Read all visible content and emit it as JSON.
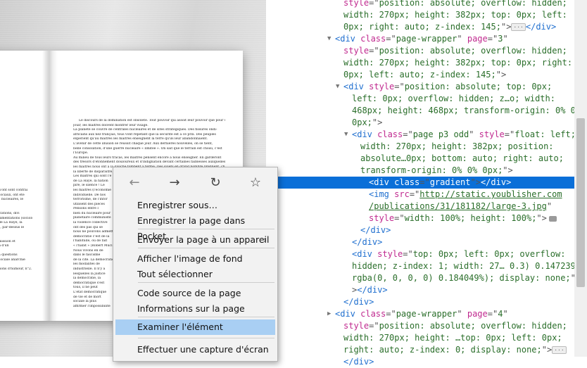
{
  "book": {
    "left_lines": [
      "",
      "",
      "",
      "",
      "",
      "",
      "",
      "n'ont sont contrai",
      "sociaux, ont été",
      "s nucléaires, le",
      "",
      "",
      "ications, divi",
      "lamentations (sociologie)",
      "de La Haye, la",
      "s, par-dessus le",
      "",
      "",
      "mission et",
      "n d'un",
      "",
      "à questions",
      "sociale anarchie",
      "",
      "tions d'humour, n°2.",
      "",
      "",
      "",
      "",
      "",
      "",
      ""
    ],
    "right_lines": [
      "Le discours de la domination est obsolète. Tout pouvoir qui assoit leur pouvoir que pour un",
      "jouir, les maîtres doivent montrer leur visage.",
      "La planète se couvre de centrales nucléaires et de sites stratégiques. Des fissurés ondi-",
      "africains aux nez français, tous vont répétant que la sécurité est à ce prix. Des peuples",
      "expérient qu'au maîtres les maîtres enseignent la terre qu'ils leur abandonnaient.",
      "L'avenir de cette illusion se réussit chaque jour. Aux dernières nouvelles, on se tient,",
      "belle consolation, d'une guerre nucléaire « limitée ». On sait que le terrain est choisi, c'est",
      "l'Europe.",
      "Au milieu de tous leurs tracas, les maîtres pensent encore à nous enseigner. En garderont",
      "des trésors d'étonnement douloureux et d'indignation devant certaines faiblesses auxquelles",
      "les maîtres nous ont à la gauche tombent à terme. Des sujets en grand nombre prennent, chaque",
      "la liberté de disparaître. Ceux qui ne sont pas des maîtres",
      "Les maîtres qui sont l'é",
      "de La Haye, la nation",
      "pire, le silence ! Le",
      "les maîtres (l'économie",
      "individuelle. De nos",
      "terrorisme, de l'infor",
      "utilisent des pièces",
      "Pensons entre l",
      "bien du nucléaire pour",
      "planétaire communiste",
      "la violence collective",
      "ont des pas qui se",
      "nous ne pouvons admettre",
      "démocratie c'est de la",
      "l'habitude, ou de fait",
      "« l'habit » (Robert Mucl",
      "Nous vivons en dé",
      "dans le fascisme",
      "de la cité. La démocratie",
      "les modalités de",
      "industrielle. Il n'y a",
      "lesquelles la justice",
      "la démocratie, la",
      "démocratique s'est",
      "tous, il ne peut",
      "L'état démocratique",
      "de vie et de mort",
      "sociale la plus",
      "affirmer l'impossibilité",
      "",
      "",
      ""
    ]
  },
  "devtools": {
    "lines": [
      {
        "indent": 1,
        "t": "none",
        "tokens": [
          {
            "c": "attr",
            "t": "style"
          },
          {
            "c": "kw",
            "t": "=\""
          },
          {
            "c": "val",
            "t": "position: absolute; overflow: hidden;"
          }
        ]
      },
      {
        "indent": 1,
        "t": "none",
        "tokens": [
          {
            "c": "val",
            "t": "width: 270px; height: 382px; top: 0px; left:"
          }
        ]
      },
      {
        "indent": 1,
        "t": "none",
        "tokens": [
          {
            "c": "val",
            "t": "0px; right: auto; z-index: 145;"
          },
          {
            "c": "kw",
            "t": "\">"
          },
          {
            "c": "ellip",
            "t": "···"
          },
          {
            "c": "tag",
            "t": "</div>"
          }
        ]
      },
      {
        "indent": 0,
        "t": "open",
        "tokens": [
          {
            "c": "tag",
            "t": "<div "
          },
          {
            "c": "attr",
            "t": "class"
          },
          {
            "c": "kw",
            "t": "=\""
          },
          {
            "c": "val",
            "t": "page-wrapper"
          },
          {
            "c": "kw",
            "t": "\" "
          },
          {
            "c": "attr",
            "t": "page"
          },
          {
            "c": "kw",
            "t": "=\""
          },
          {
            "c": "val",
            "t": "3"
          },
          {
            "c": "kw",
            "t": "\""
          }
        ]
      },
      {
        "indent": 1,
        "t": "none",
        "tokens": [
          {
            "c": "attr",
            "t": "style"
          },
          {
            "c": "kw",
            "t": "=\""
          },
          {
            "c": "val",
            "t": "position: absolute; overflow: hidden;"
          }
        ]
      },
      {
        "indent": 1,
        "t": "none",
        "tokens": [
          {
            "c": "val",
            "t": "width: 270px; height: 382px; top: 0px; right:"
          }
        ]
      },
      {
        "indent": 1,
        "t": "none",
        "tokens": [
          {
            "c": "val",
            "t": "0px; left: auto; z-index: 145;"
          },
          {
            "c": "kw",
            "t": "\">"
          }
        ]
      },
      {
        "indent": 1,
        "t": "open",
        "tokens": [
          {
            "c": "tag",
            "t": "<div "
          },
          {
            "c": "attr",
            "t": "style"
          },
          {
            "c": "kw",
            "t": "=\""
          },
          {
            "c": "val",
            "t": "position: absolute; top: 0px;"
          }
        ]
      },
      {
        "indent": 2,
        "t": "none",
        "tokens": [
          {
            "c": "val",
            "t": "left: 0px; overflow: hidden; z…o; width:"
          }
        ]
      },
      {
        "indent": 2,
        "t": "none",
        "tokens": [
          {
            "c": "val",
            "t": "468px; height: 468px; transform-origin: 0% 0%"
          }
        ]
      },
      {
        "indent": 2,
        "t": "none",
        "tokens": [
          {
            "c": "val",
            "t": "0px;"
          },
          {
            "c": "kw",
            "t": "\">"
          }
        ]
      },
      {
        "indent": 2,
        "t": "open",
        "tokens": [
          {
            "c": "tag",
            "t": "<div "
          },
          {
            "c": "attr",
            "t": "class"
          },
          {
            "c": "kw",
            "t": "=\""
          },
          {
            "c": "val",
            "t": "page p3 odd"
          },
          {
            "c": "kw",
            "t": "\" "
          },
          {
            "c": "attr",
            "t": "style"
          },
          {
            "c": "kw",
            "t": "=\""
          },
          {
            "c": "val",
            "t": "float: left;"
          }
        ]
      },
      {
        "indent": 3,
        "t": "none",
        "tokens": [
          {
            "c": "val",
            "t": "width: 270px; height: 382px; position:"
          }
        ]
      },
      {
        "indent": 3,
        "t": "none",
        "tokens": [
          {
            "c": "val",
            "t": "absolute…0px; bottom: auto; right: auto;"
          }
        ]
      },
      {
        "indent": 3,
        "t": "none",
        "tokens": [
          {
            "c": "val",
            "t": "transform-origin: 0% 0% 0px;"
          },
          {
            "c": "kw",
            "t": "\">"
          }
        ]
      },
      {
        "indent": 4,
        "t": "none",
        "sel": true,
        "tokens": [
          {
            "c": "tag",
            "t": "<div "
          },
          {
            "c": "attr",
            "t": "class"
          },
          {
            "c": "kw",
            "t": "=\""
          },
          {
            "c": "val",
            "t": "gradient"
          },
          {
            "c": "kw",
            "t": "\">"
          },
          {
            "c": "tag",
            "t": "</div>"
          }
        ]
      },
      {
        "indent": 4,
        "t": "none",
        "tokens": [
          {
            "c": "tag",
            "t": "<img "
          },
          {
            "c": "attr",
            "t": "src"
          },
          {
            "c": "kw",
            "t": "=\""
          },
          {
            "c": "link",
            "t": "http://static.youblisher.com"
          }
        ]
      },
      {
        "indent": 4,
        "t": "none",
        "tokens": [
          {
            "c": "link",
            "t": "/publications/31/181182/large-3.jpg"
          },
          {
            "c": "kw",
            "t": "\""
          }
        ]
      },
      {
        "indent": 4,
        "t": "none",
        "tokens": [
          {
            "c": "attr",
            "t": "style"
          },
          {
            "c": "kw",
            "t": "=\""
          },
          {
            "c": "val",
            "t": "width: 100%; height: 100%;"
          },
          {
            "c": "kw",
            "t": "\">"
          },
          {
            "c": "badge",
            "t": ""
          }
        ]
      },
      {
        "indent": 3,
        "t": "none",
        "tokens": [
          {
            "c": "tag",
            "t": "</div>"
          }
        ]
      },
      {
        "indent": 2,
        "t": "none",
        "tokens": [
          {
            "c": "tag",
            "t": "</div>"
          }
        ]
      },
      {
        "indent": 2,
        "t": "none",
        "tokens": [
          {
            "c": "tag",
            "t": "<div "
          },
          {
            "c": "attr",
            "t": "style"
          },
          {
            "c": "kw",
            "t": "=\""
          },
          {
            "c": "val",
            "t": "top: 0px; left: 0px; overflow:"
          }
        ]
      },
      {
        "indent": 2,
        "t": "none",
        "tokens": [
          {
            "c": "val",
            "t": "hidden; z-index: 1; width: 27… 0.3) 0.147239%,"
          }
        ]
      },
      {
        "indent": 2,
        "t": "none",
        "tokens": [
          {
            "c": "val",
            "t": "rgba(0, 0, 0, 0) 0.184049%); display: none;"
          },
          {
            "c": "kw",
            "t": "\""
          }
        ]
      },
      {
        "indent": 2,
        "t": "none",
        "tokens": [
          {
            "c": "kw",
            "t": ">"
          },
          {
            "c": "tag",
            "t": "</div>"
          }
        ]
      },
      {
        "indent": 1,
        "t": "none",
        "tokens": [
          {
            "c": "tag",
            "t": "</div>"
          }
        ]
      },
      {
        "indent": 0,
        "t": "closed",
        "tokens": [
          {
            "c": "tag",
            "t": "<div "
          },
          {
            "c": "attr",
            "t": "class"
          },
          {
            "c": "kw",
            "t": "=\""
          },
          {
            "c": "val",
            "t": "page-wrapper"
          },
          {
            "c": "kw",
            "t": "\" "
          },
          {
            "c": "attr",
            "t": "page"
          },
          {
            "c": "kw",
            "t": "=\""
          },
          {
            "c": "val",
            "t": "4"
          },
          {
            "c": "kw",
            "t": "\""
          }
        ]
      },
      {
        "indent": 1,
        "t": "none",
        "tokens": [
          {
            "c": "attr",
            "t": "style"
          },
          {
            "c": "kw",
            "t": "=\""
          },
          {
            "c": "val",
            "t": "position: absolute; overflow: hidden;"
          }
        ]
      },
      {
        "indent": 1,
        "t": "none",
        "tokens": [
          {
            "c": "val",
            "t": "width: 270px; height: …top: 0px; left: 0px;"
          }
        ]
      },
      {
        "indent": 1,
        "t": "none",
        "tokens": [
          {
            "c": "val",
            "t": "right: auto; z-index: 0; display: none;"
          },
          {
            "c": "kw",
            "t": "\">"
          },
          {
            "c": "ellip",
            "t": "···"
          }
        ]
      },
      {
        "indent": 1,
        "t": "none",
        "tokens": [
          {
            "c": "tag",
            "t": "</div>"
          }
        ]
      }
    ]
  },
  "context_menu": {
    "nav": [
      {
        "name": "back-arrow-icon",
        "glyph": "←"
      },
      {
        "name": "forward-arrow-icon",
        "glyph": "→"
      },
      {
        "name": "reload-icon",
        "glyph": "↻"
      },
      {
        "name": "bookmark-star-icon",
        "glyph": "☆"
      }
    ],
    "items": [
      {
        "label": "Enregistrer sous…"
      },
      {
        "label": "Enregistrer la page dans Pocket"
      },
      {
        "label": "Envoyer la page à un appareil",
        "submenu": true
      },
      {
        "label": "Afficher l'image de fond"
      },
      {
        "label": "Tout sélectionner"
      },
      {
        "label": "Code source de la page"
      },
      {
        "label": "Informations sur la page"
      },
      {
        "label": "Examiner l'élément",
        "highlighted": true
      },
      {
        "label": "Effectuer une capture d'écran"
      }
    ]
  }
}
